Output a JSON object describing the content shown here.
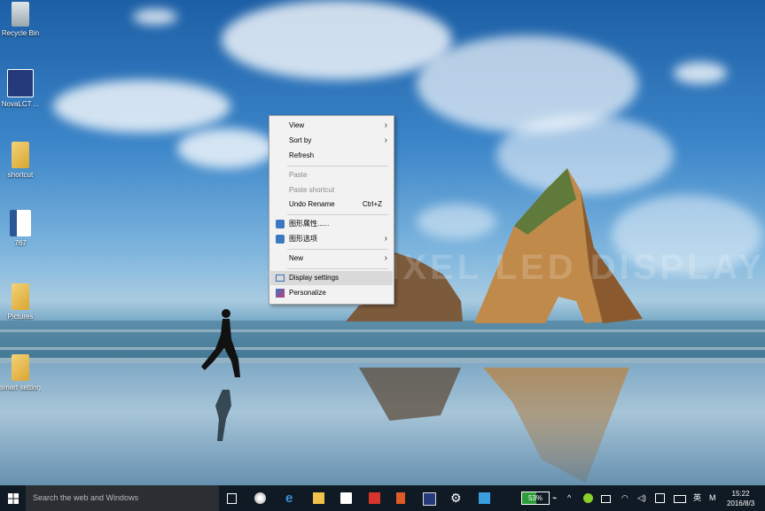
{
  "desktop": {
    "icons": [
      {
        "label": "Recycle Bin",
        "icon": "recycle-bin-icon"
      },
      {
        "label": "NovaLCT ...",
        "icon": "novalct-icon"
      },
      {
        "label": "shortcut",
        "icon": "folder-icon"
      },
      {
        "label": "767",
        "icon": "word-document-icon"
      },
      {
        "label": "Pictures",
        "icon": "folder-icon"
      },
      {
        "label": "smart setting",
        "icon": "folder-icon"
      }
    ],
    "watermark": "SKY PIXEL LED DISPLAY"
  },
  "context_menu": {
    "items": [
      {
        "label": "View",
        "submenu": true,
        "enabled": true
      },
      {
        "label": "Sort by",
        "submenu": true,
        "enabled": true
      },
      {
        "label": "Refresh",
        "submenu": false,
        "enabled": true
      },
      {
        "label": "Paste",
        "submenu": false,
        "enabled": false
      },
      {
        "label": "Paste shortcut",
        "submenu": false,
        "enabled": false
      },
      {
        "label": "Undo Rename",
        "shortcut": "Ctrl+Z",
        "submenu": false,
        "enabled": true
      },
      {
        "label": "图形属性......",
        "submenu": false,
        "enabled": true
      },
      {
        "label": "图形选项",
        "submenu": true,
        "enabled": true
      },
      {
        "label": "New",
        "submenu": true,
        "enabled": true
      },
      {
        "label": "Display settings",
        "submenu": false,
        "enabled": true,
        "highlighted": true
      },
      {
        "label": "Personalize",
        "submenu": false,
        "enabled": true
      }
    ]
  },
  "taskbar": {
    "search_placeholder": "Search the web and Windows",
    "battery": "53%",
    "language": "英",
    "ime": "M",
    "time": "15:22",
    "date": "2016/8/3"
  },
  "colors": {
    "taskbar": "#101a24",
    "menu_bg": "#f2f2f2",
    "highlight": "#dadada"
  }
}
